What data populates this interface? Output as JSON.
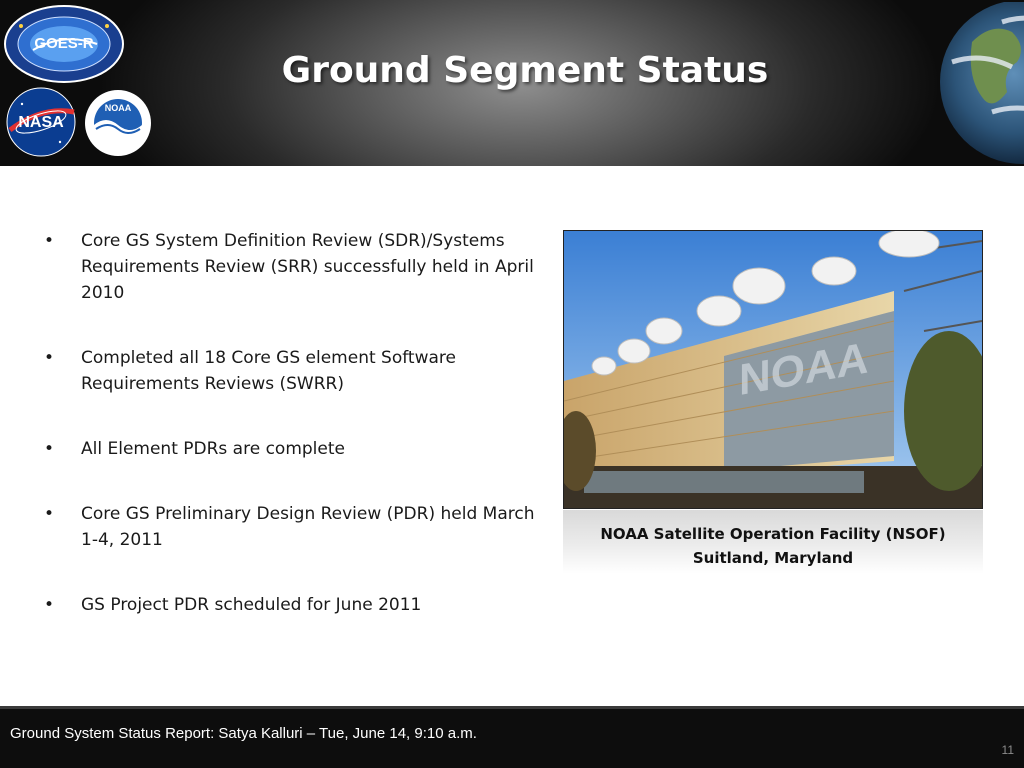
{
  "header": {
    "title": "Ground Segment Status",
    "logos": {
      "goes": {
        "icon": "goes-r-logo",
        "text": "GOES-R"
      },
      "nasa": {
        "icon": "nasa-logo",
        "text": "NASA"
      },
      "noaa": {
        "icon": "noaa-logo",
        "text": "NOAA"
      },
      "earth": {
        "icon": "earth-globe-image"
      }
    }
  },
  "bullets": [
    "Core GS System Definition Review (SDR)/Systems Requirements Review (SRR) successfully held in April 2010",
    "Completed all 18 Core GS element Software Requirements Reviews (SWRR)",
    "All Element PDRs are complete",
    "Core GS Preliminary Design Review (PDR) held March 1-4, 2011",
    "GS Project PDR scheduled for June 2011"
  ],
  "bullet_marker": "•",
  "photo": {
    "icon": "nsof-building-photo",
    "building_sign": "NOAA",
    "caption_line1": "NOAA Satellite Operation Facility (NSOF)",
    "caption_line2": "Suitland, Maryland"
  },
  "footer": {
    "text": "Ground System Status Report:  Satya Kalluri  – Tue,  June 14,  9:10 a.m.",
    "page_number": "11"
  },
  "colors": {
    "header_dark": "#0c0c0c",
    "header_light": "#8e8e8e",
    "footer_bg": "#0d0d0d",
    "caption_bg": "#e0e0e0"
  }
}
